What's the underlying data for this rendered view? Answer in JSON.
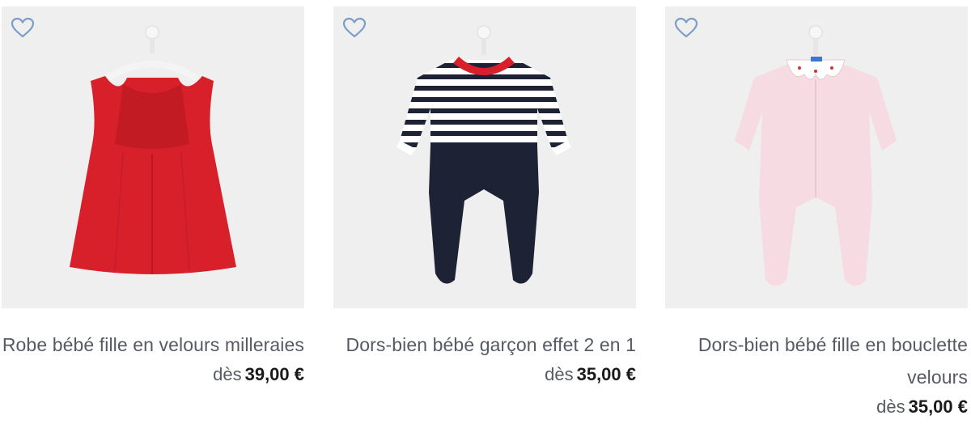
{
  "accent_color": "#7a9cc6",
  "products": [
    {
      "name": "Robe bébé fille en velours milleraies",
      "price_prefix": "dès",
      "price": "39,00 €",
      "favorite_icon": "heart-outline-icon",
      "garment_color": "#d8202a"
    },
    {
      "name": "Dors-bien bébé garçon effet 2 en 1",
      "price_prefix": "dès",
      "price": "35,00 €",
      "favorite_icon": "heart-outline-icon",
      "garment_color": "#1d2235"
    },
    {
      "name": "Dors-bien bébé fille en bouclette velours",
      "price_prefix": "dès",
      "price": "35,00 €",
      "favorite_icon": "heart-outline-icon",
      "garment_color": "#f6dbe2"
    }
  ]
}
